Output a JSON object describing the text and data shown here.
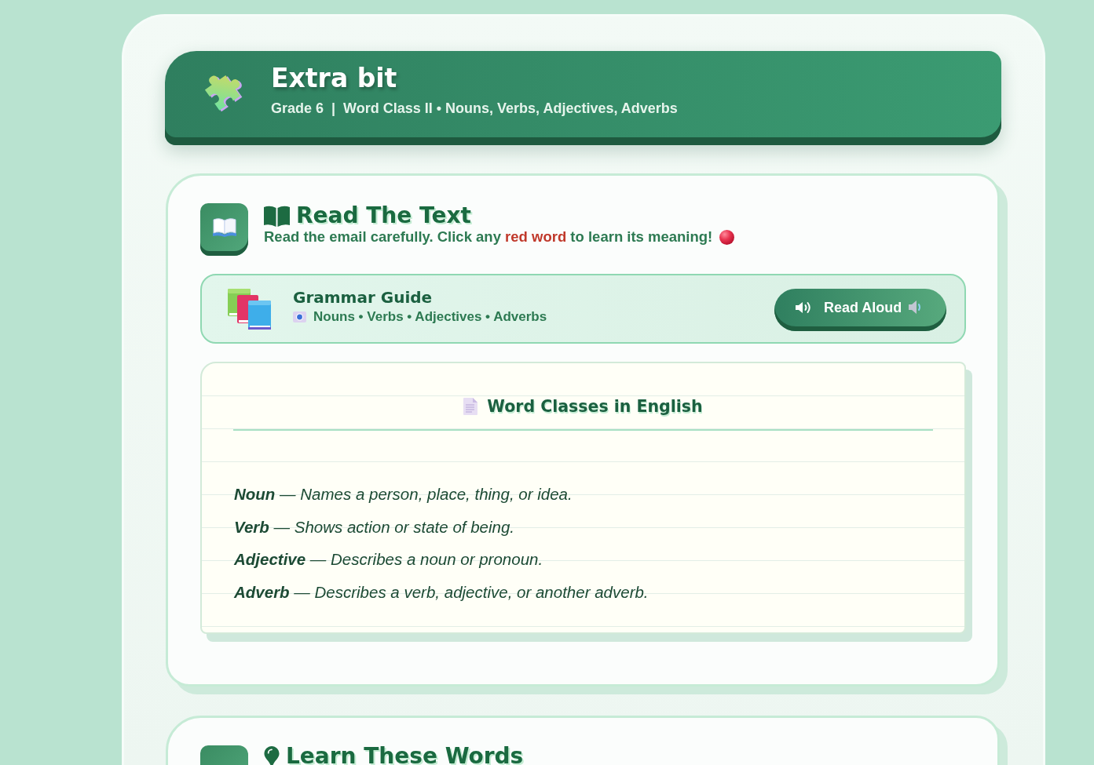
{
  "header": {
    "title": "Extra bit",
    "subtitle": "Grade 6  |  Word Class II • Nouns, Verbs, Adjectives, Adverbs"
  },
  "sections": [
    {
      "title": "Read The Text",
      "instruction": "Read the email carefully. Click any **red word** to learn its meaning!",
      "guide": {
        "title": "Grammar Guide",
        "subtitle": "Nouns • Verbs • Adjectives • Adverbs",
        "button": "Read Aloud"
      },
      "document": {
        "title": "Word Classes in English",
        "lines": [
          "**Noun** — Names a person, place, thing, or idea.",
          "**Verb** — Shows action or state of being.",
          "**Adjective** — Describes a noun or pronoun.",
          "**Adverb** — Describes a verb, adjective, or another adverb."
        ]
      }
    },
    {
      "title": "Learn These Words"
    }
  ]
}
